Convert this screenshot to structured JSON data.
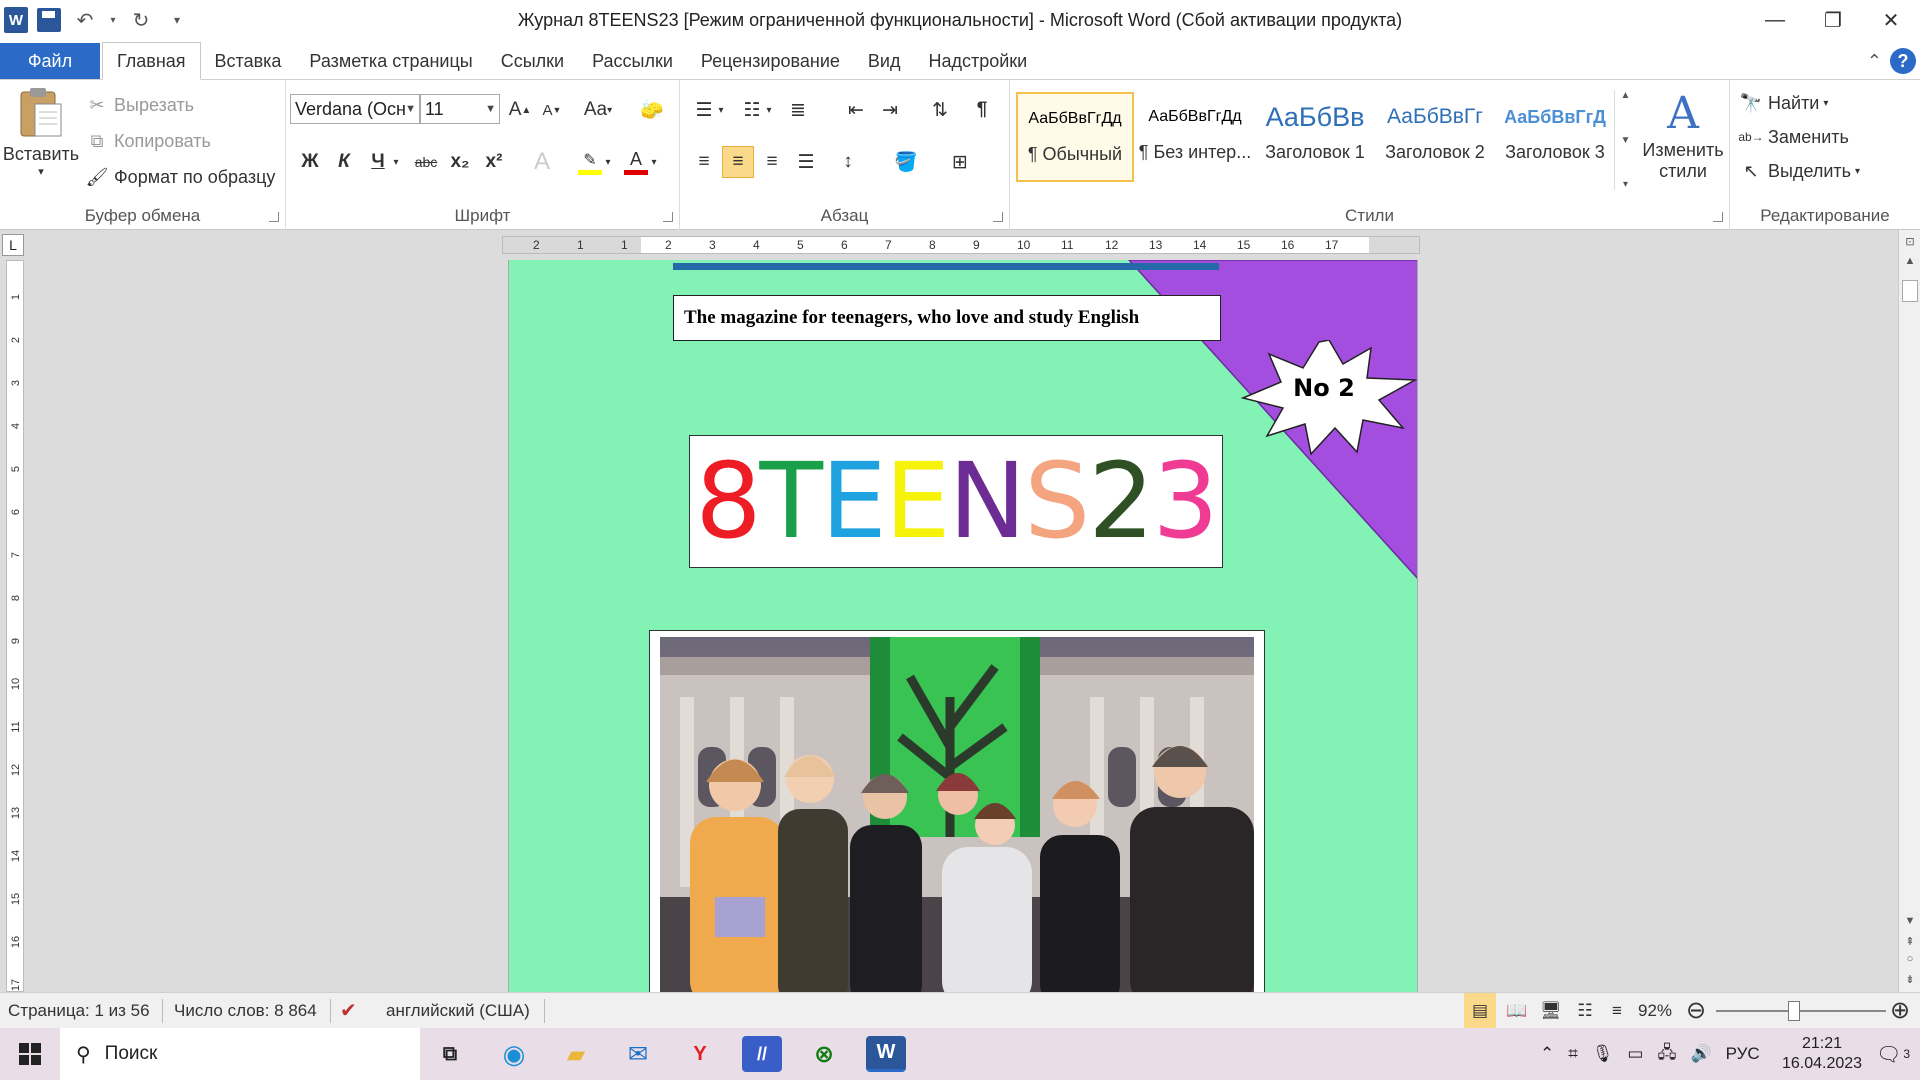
{
  "titlebar": {
    "title": "Журнал 8TEENS23 [Режим ограниченной функциональности]  -  Microsoft Word (Сбой активации продукта)",
    "word_logo": "W"
  },
  "tabs": [
    {
      "label": "Файл"
    },
    {
      "label": "Главная"
    },
    {
      "label": "Вставка"
    },
    {
      "label": "Разметка страницы"
    },
    {
      "label": "Ссылки"
    },
    {
      "label": "Рассылки"
    },
    {
      "label": "Рецензирование"
    },
    {
      "label": "Вид"
    },
    {
      "label": "Надстройки"
    }
  ],
  "ribbon": {
    "clipboard": {
      "label": "Буфер обмена",
      "paste": "Вставить",
      "cut": "Вырезать",
      "copy": "Копировать",
      "format_painter": "Формат по образцу"
    },
    "font": {
      "label": "Шрифт",
      "font_name": "Verdana (Осн",
      "font_size": "11",
      "bold": "Ж",
      "italic": "К",
      "underline": "Ч",
      "strike": "abc",
      "sub": "x₂",
      "sup": "x²",
      "case": "Aa"
    },
    "paragraph": {
      "label": "Абзац"
    },
    "styles": {
      "label": "Стили",
      "items": [
        {
          "sample": "АаБбВвГгДд",
          "name": "¶ Обычный"
        },
        {
          "sample": "АаБбВвГгДд",
          "name": "¶ Без интер..."
        },
        {
          "sample": "АаБбВв",
          "name": "Заголовок 1"
        },
        {
          "sample": "АаБбВвГг",
          "name": "Заголовок 2"
        },
        {
          "sample": "АаБбВвГгД",
          "name": "Заголовок 3"
        }
      ],
      "change_styles_1": "Изменить",
      "change_styles_2": "стили"
    },
    "editing": {
      "label": "Редактирование",
      "find": "Найти",
      "replace": "Заменить",
      "select": "Выделить"
    }
  },
  "ruler": {
    "h_numbers": [
      "2",
      "1",
      "1",
      "2",
      "3",
      "4",
      "5",
      "6",
      "7",
      "8",
      "9",
      "10",
      "11",
      "12",
      "13",
      "14",
      "15",
      "16",
      "17"
    ],
    "v_numbers": [
      "1",
      "2",
      "3",
      "4",
      "5",
      "6",
      "7",
      "8",
      "9",
      "10",
      "11",
      "12",
      "13",
      "14",
      "15",
      "16",
      "17"
    ]
  },
  "document": {
    "tagline": "The magazine for teenagers, who love and study  English",
    "issue": "No 2",
    "logo_letters": [
      {
        "ch": "8",
        "color": "#ee1c24"
      },
      {
        "ch": "T",
        "color": "#1aa04a"
      },
      {
        "ch": "E",
        "color": "#1fa3e0"
      },
      {
        "ch": "E",
        "color": "#f6f20a"
      },
      {
        "ch": "N",
        "color": "#6c2c93"
      },
      {
        "ch": "S",
        "color": "#f4a47f"
      },
      {
        "ch": "2",
        "color": "#2f4f24"
      },
      {
        "ch": "3",
        "color": "#ef3b94"
      }
    ],
    "page_bg": "#82f3b5",
    "triangle_color": "#a44ee0"
  },
  "statusbar": {
    "page": "Страница: 1 из 56",
    "words": "Число слов: 8 864",
    "language": "английский (США)",
    "zoom": "92%",
    "zoom_level_percent": 92
  },
  "taskbar": {
    "search": "Поиск",
    "lang": "РУС",
    "time": "21:21",
    "date": "16.04.2023",
    "notifications": "3"
  }
}
